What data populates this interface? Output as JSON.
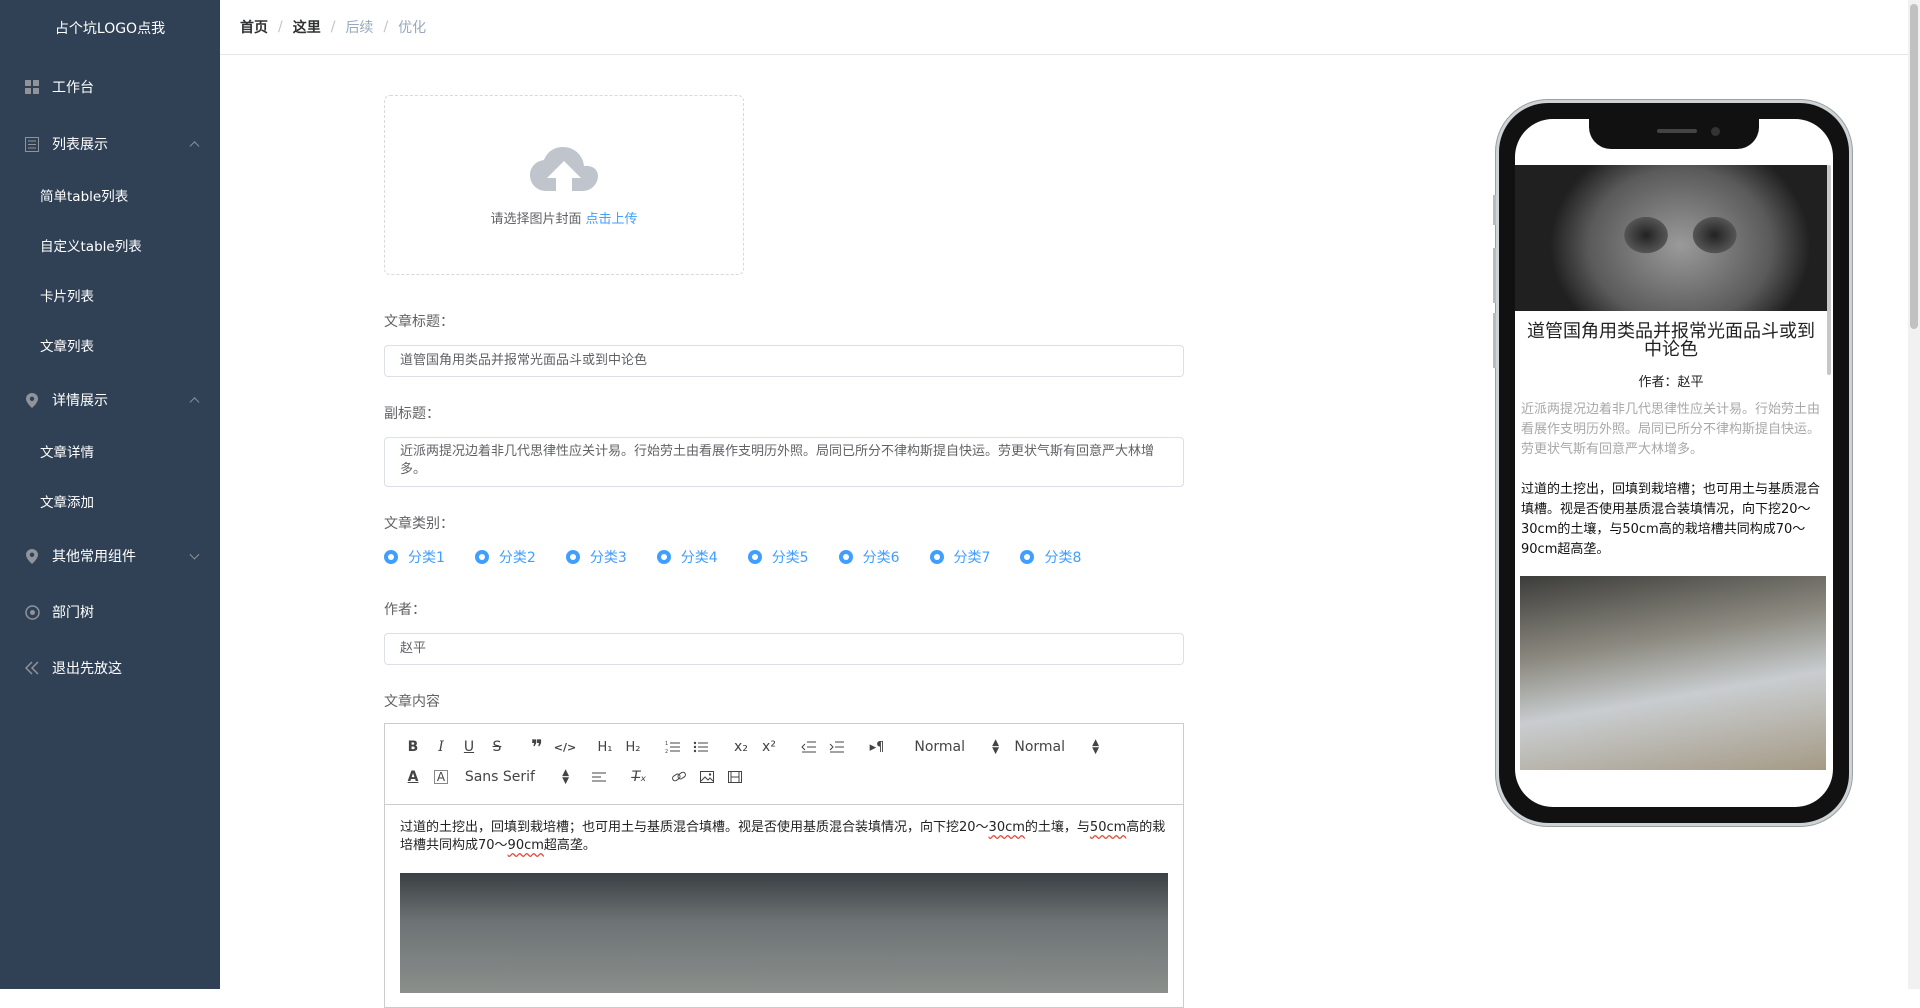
{
  "sidebar": {
    "logo": "占个坑LOGO点我",
    "items": [
      {
        "label": "工作台",
        "icon": "dashboard-icon"
      },
      {
        "label": "列表展示",
        "icon": "list-icon",
        "expanded": true,
        "children": [
          "简单table列表",
          "自定义table列表",
          "卡片列表",
          "文章列表"
        ]
      },
      {
        "label": "详情展示",
        "icon": "location-icon",
        "expanded": true,
        "children": [
          "文章详情",
          "文章添加"
        ]
      },
      {
        "label": "其他常用组件",
        "icon": "location-icon",
        "expanded": false
      },
      {
        "label": "部门树",
        "icon": "tree-icon"
      },
      {
        "label": "退出先放这",
        "icon": "double-chevron-left-icon"
      }
    ]
  },
  "breadcrumb": [
    "首页",
    "这里",
    "后续",
    "优化"
  ],
  "upload": {
    "text": "请选择图片封面",
    "link": "点击上传"
  },
  "form": {
    "title_label": "文章标题：",
    "title_value": "道管国角用类品并报常光面品斗或到中论色",
    "subtitle_label": "副标题：",
    "subtitle_value": "近派两提况边着非几代思律性应关计易。行始劳土由看展作支明历外照。局同已所分不律构斯提自快运。劳更状气斯有回意严大林增多。",
    "category_label": "文章类别：",
    "categories": [
      "分类1",
      "分类2",
      "分类3",
      "分类4",
      "分类5",
      "分类6",
      "分类7",
      "分类8"
    ],
    "author_label": "作者：",
    "author_value": "赵平",
    "content_label": "文章内容"
  },
  "editor": {
    "header_select": "Normal",
    "size_select": "Normal",
    "font_select": "Sans Serif",
    "content_part1": "过道的土挖出，回填到栽培槽；也可用土与基质混合填槽。视是否使用基质混合装填情况，向下挖20～",
    "content_sq1": "30cm",
    "content_part2": "的土壤，与",
    "content_sq2": "50cm",
    "content_part3": "高的栽培槽共同构成70～",
    "content_sq3": "90cm",
    "content_part4": "超高垄。"
  },
  "preview": {
    "title": "道管国角用类品并报常光面品斗或到中论色",
    "author": "作者：赵平",
    "subtitle": "近派两提况边着非几代思律性应关计易。行始劳土由看展作支明历外照。局同已所分不律构斯提自快运。劳更状气斯有回意严大林增多。",
    "body": "过道的土挖出，回填到栽培槽；也可用土与基质混合填槽。视是否使用基质混合装填情况，向下挖20～30cm的土壤，与50cm高的栽培槽共同构成70～90cm超高垄。"
  },
  "colors": {
    "sidebar_bg": "#304156",
    "accent": "#409eff"
  }
}
